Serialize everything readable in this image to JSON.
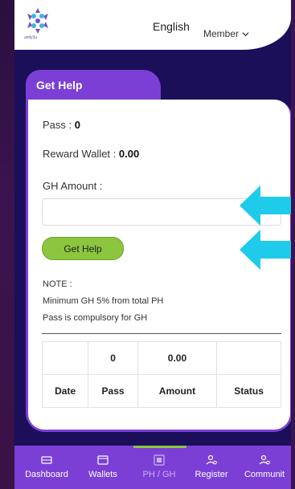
{
  "header": {
    "logo_text": "unity3u",
    "language": "English",
    "member_label": "Member"
  },
  "card": {
    "title": "Get Help",
    "pass_label": "Pass : ",
    "pass_value": "0",
    "reward_label": "Reward Wallet : ",
    "reward_value": "0.00",
    "gh_amount_label": "GH Amount :",
    "gh_amount_value": "",
    "button_label": "Get Help",
    "note_title": "NOTE :",
    "note_line1": "Minimum GH 5% from total PH",
    "note_line2": "Pass is compulsory for GH"
  },
  "table": {
    "summary": [
      "",
      "0",
      "0.00",
      ""
    ],
    "headers": [
      "Date",
      "Pass",
      "Amount",
      "Status"
    ]
  },
  "nav": {
    "items": [
      {
        "label": "Dashboard",
        "icon": "ticket-icon"
      },
      {
        "label": "Wallets",
        "icon": "wallet-icon"
      },
      {
        "label": "PH / GH",
        "icon": "square-icon"
      },
      {
        "label": "Register",
        "icon": "add-user-icon"
      },
      {
        "label": "Communit",
        "icon": "users-icon"
      }
    ]
  },
  "colors": {
    "brand": "#7b3fd6",
    "background": "#1c0f5a",
    "button": "#8cc63f",
    "arrow": "#1ecbea"
  }
}
